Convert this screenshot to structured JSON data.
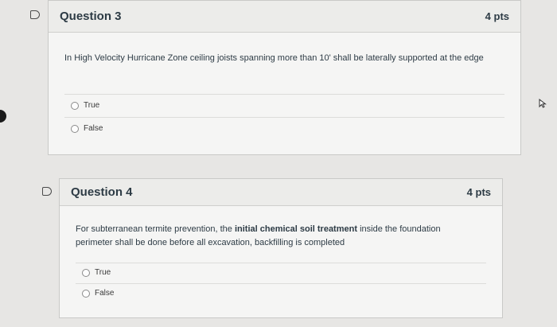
{
  "questions": [
    {
      "title": "Question 3",
      "points": "4 pts",
      "text": "In High Velocity Hurricane Zone ceiling joists spanning more than 10' shall be laterally supported at the edge",
      "answers": [
        "True",
        "False"
      ]
    },
    {
      "title": "Question 4",
      "points": "4 pts",
      "text_parts": {
        "before": "For subterranean termite prevention, the ",
        "bold": "initial chemical soil treatment",
        "after": " inside the foundation perimeter shall be done before all excavation, backfilling is completed"
      },
      "answers": [
        "True",
        "False"
      ]
    }
  ]
}
